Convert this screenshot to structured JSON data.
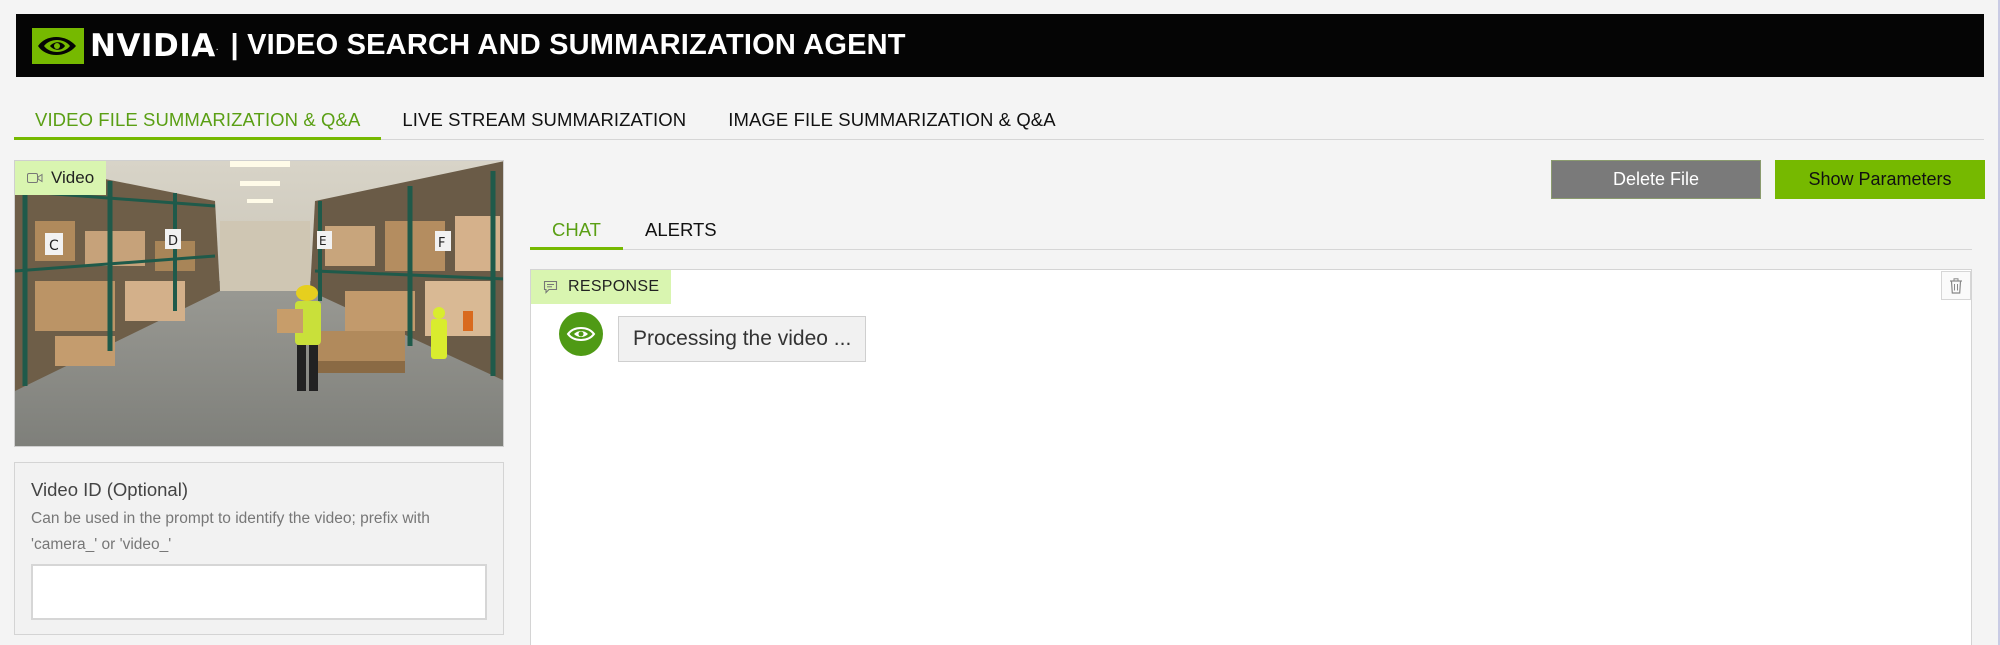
{
  "header": {
    "brand": "NVIDIA",
    "title": "| VIDEO SEARCH AND SUMMARIZATION AGENT"
  },
  "main_tabs": [
    {
      "label": "VIDEO FILE SUMMARIZATION & Q&A",
      "active": true
    },
    {
      "label": "LIVE STREAM SUMMARIZATION",
      "active": false
    },
    {
      "label": "IMAGE FILE SUMMARIZATION & Q&A",
      "active": false
    }
  ],
  "video_panel": {
    "badge": "Video",
    "shelf_labels": [
      "C",
      "D",
      "E",
      "F"
    ]
  },
  "video_id": {
    "label": "Video ID (Optional)",
    "info": "Can be used in the prompt to identify the video; prefix with 'camera_' or 'video_'",
    "value": "",
    "placeholder": ""
  },
  "buttons": {
    "delete": "Delete File",
    "show_params": "Show Parameters"
  },
  "chat_tabs": [
    {
      "label": "CHAT",
      "active": true
    },
    {
      "label": "ALERTS",
      "active": false
    }
  ],
  "response": {
    "badge": "RESPONSE",
    "message": "Processing the video ..."
  },
  "colors": {
    "accent": "#76b900",
    "accent_text": "#5a9f14",
    "badge_bg": "#d9f5b0",
    "banner_bg": "#050505",
    "delete_btn": "#7a7a7a"
  },
  "icons": [
    "nvidia-eye-icon",
    "video-camera-icon",
    "chat-bubble-icon",
    "trash-icon"
  ]
}
